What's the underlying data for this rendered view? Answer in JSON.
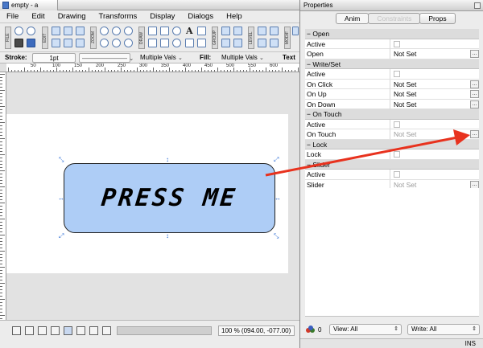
{
  "editor": {
    "window_title": "empty - a",
    "menu": [
      "File",
      "Edit",
      "Drawing",
      "Transforms",
      "Display",
      "Dialogs",
      "Help"
    ],
    "toolbar_group_labels": [
      "FILE",
      "EDIT",
      "ZOOM",
      "DRAW",
      "GROUP",
      "LEVEL",
      "MODIF"
    ],
    "toolbar_text_tool": "A",
    "stroke_label": "Stroke:",
    "stroke_width": "1pt",
    "stroke_value": "Multiple Vals",
    "fill_label": "Fill:",
    "fill_value": "Multiple Vals",
    "text_label": "Text",
    "ruler_numbers": [
      "50",
      "100",
      "150",
      "200",
      "250",
      "300",
      "350",
      "400",
      "450",
      "500",
      "550",
      "600"
    ],
    "canvas_button_text": "PRESS ME",
    "zoom_readout": "100 % (094.00, -077.00)"
  },
  "properties": {
    "title": "Properties",
    "tabs": [
      {
        "label": "Anim",
        "state": "normal"
      },
      {
        "label": "Constraints",
        "state": "disabled"
      },
      {
        "label": "Props",
        "state": "active"
      }
    ],
    "sections": [
      {
        "title": "Open",
        "rows": [
          {
            "label": "Active",
            "type": "checkbox"
          },
          {
            "label": "Open",
            "value": "Not Set",
            "dim": false,
            "more": true
          }
        ]
      },
      {
        "title": "Write/Set",
        "rows": [
          {
            "label": "Active",
            "type": "checkbox"
          },
          {
            "label": "On Click",
            "value": "Not Set",
            "dim": false,
            "more": true
          },
          {
            "label": "On Up",
            "value": "Not Set",
            "dim": false,
            "more": true
          },
          {
            "label": "On Down",
            "value": "Not Set",
            "dim": false,
            "more": true
          }
        ]
      },
      {
        "title": "On Touch",
        "rows": [
          {
            "label": "Active",
            "type": "checkbox"
          },
          {
            "label": "On Touch",
            "value": "Not Set",
            "dim": true,
            "more": true
          }
        ]
      },
      {
        "title": "Lock",
        "rows": [
          {
            "label": "Lock",
            "type": "checkbox"
          }
        ]
      },
      {
        "title": "Slider",
        "rows": [
          {
            "label": "Active",
            "type": "checkbox"
          },
          {
            "label": "Slider",
            "value": "Not Set",
            "dim": true,
            "more": true
          }
        ]
      }
    ],
    "footer_count": "0",
    "view_select": "View: All",
    "write_select": "Write: All",
    "status_mode": "INS"
  },
  "colors": {
    "button_fill": "#aecdf6",
    "arrow": "#e8321e",
    "handle": "#2f6fd6"
  }
}
